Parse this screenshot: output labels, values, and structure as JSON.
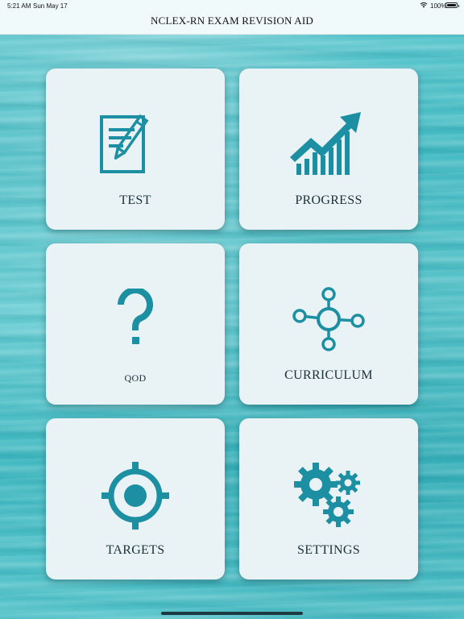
{
  "status_bar": {
    "time": "5:21 AM",
    "date": "Sun May 17",
    "battery_percent": "100%"
  },
  "nav": {
    "title": "NCLEX-RN EXAM REVISION AID"
  },
  "tiles": [
    {
      "label": "TEST",
      "icon": "test-document-pencil-icon"
    },
    {
      "label": "PROGRESS",
      "icon": "progress-chart-arrow-icon"
    },
    {
      "label": "QOD",
      "icon": "question-mark-icon"
    },
    {
      "label": "CURRICULUM",
      "icon": "curriculum-network-icon"
    },
    {
      "label": "TARGETS",
      "icon": "target-crosshair-icon"
    },
    {
      "label": "SETTINGS",
      "icon": "settings-gears-icon"
    }
  ],
  "colors": {
    "icon": "#1d8fa3",
    "tile_background": "#e9f3f5",
    "background": "#4fc2c9"
  }
}
